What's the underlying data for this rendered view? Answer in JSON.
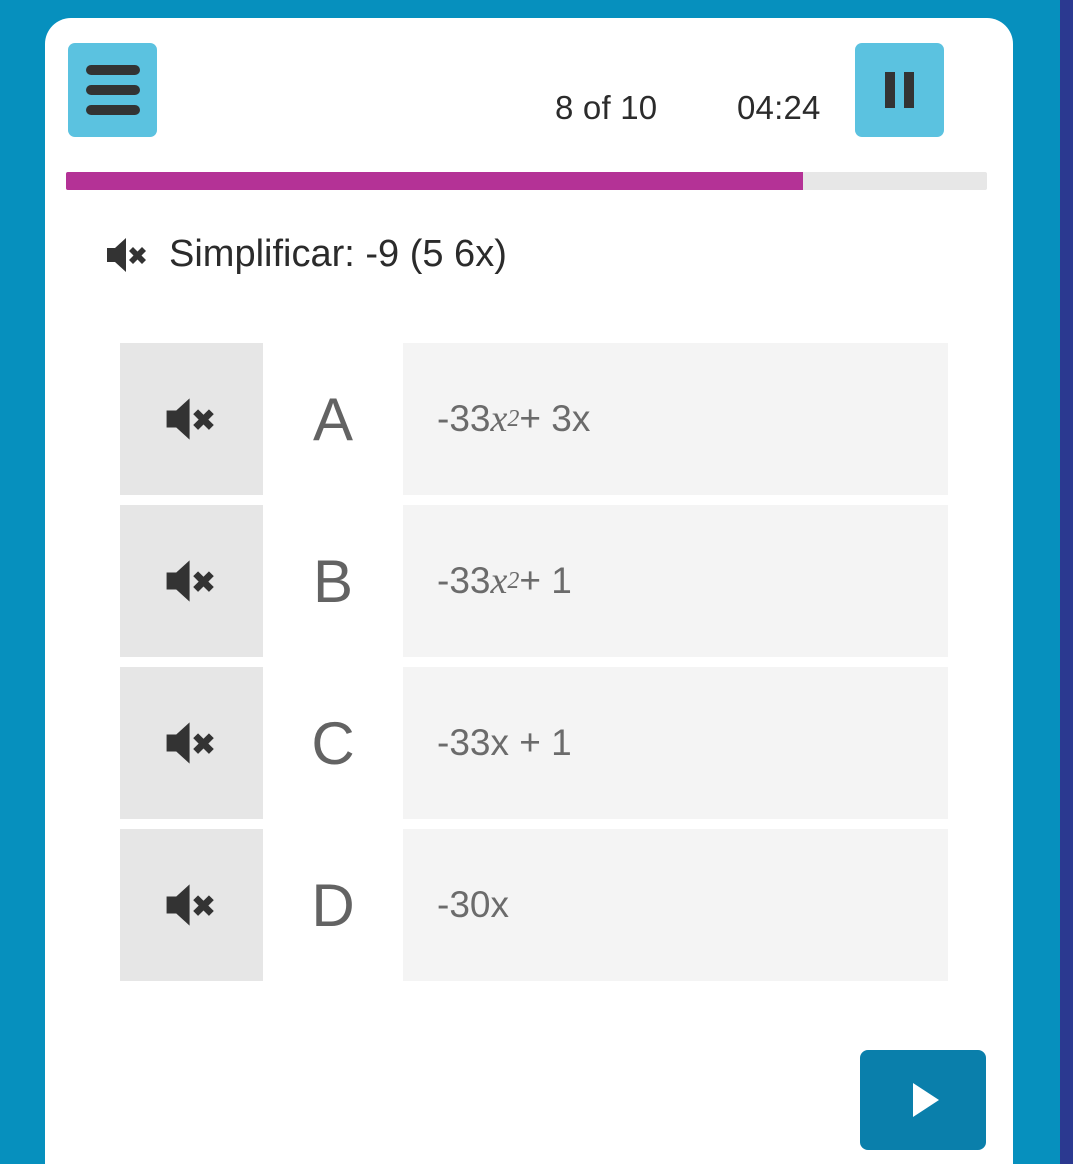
{
  "app": {
    "background_color": "#0690be",
    "edge_strip_color": "#2b3990",
    "card_color": "#ffffff"
  },
  "header": {
    "menu_label": "Menu",
    "menu_icon": "hamburger-icon",
    "counter": "8 of 10",
    "timer": "04:24",
    "pause_label": "Pause",
    "pause_icon": "pause-icon",
    "button_color": "#5bc2e0"
  },
  "progress": {
    "percent": 80,
    "fill_color": "#b43296",
    "track_color": "#e7e7e7",
    "label": "8 of 10"
  },
  "question": {
    "speaker_icon": "speaker-muted-icon",
    "text": "Simplificar: -9 (5 6x)"
  },
  "answers": {
    "speaker_icon": "speaker-muted-icon",
    "options": [
      {
        "letter": "A",
        "text": "-33x2 + 3x",
        "prefix": "-33",
        "variable": "x",
        "exponent": "2",
        "suffix": " + 3x"
      },
      {
        "letter": "B",
        "text": "-33x2 + 1",
        "prefix": "-33",
        "variable": "x",
        "exponent": "2",
        "suffix": " + 1"
      },
      {
        "letter": "C",
        "text": "-33x + 1",
        "prefix": "-33x + 1",
        "variable": "",
        "exponent": "",
        "suffix": ""
      },
      {
        "letter": "D",
        "text": "-30x",
        "prefix": "-30x",
        "variable": "",
        "exponent": "",
        "suffix": ""
      }
    ]
  },
  "footer": {
    "next_label": "Next",
    "next_icon": "play-triangle-icon",
    "next_color": "#0a7fab"
  }
}
